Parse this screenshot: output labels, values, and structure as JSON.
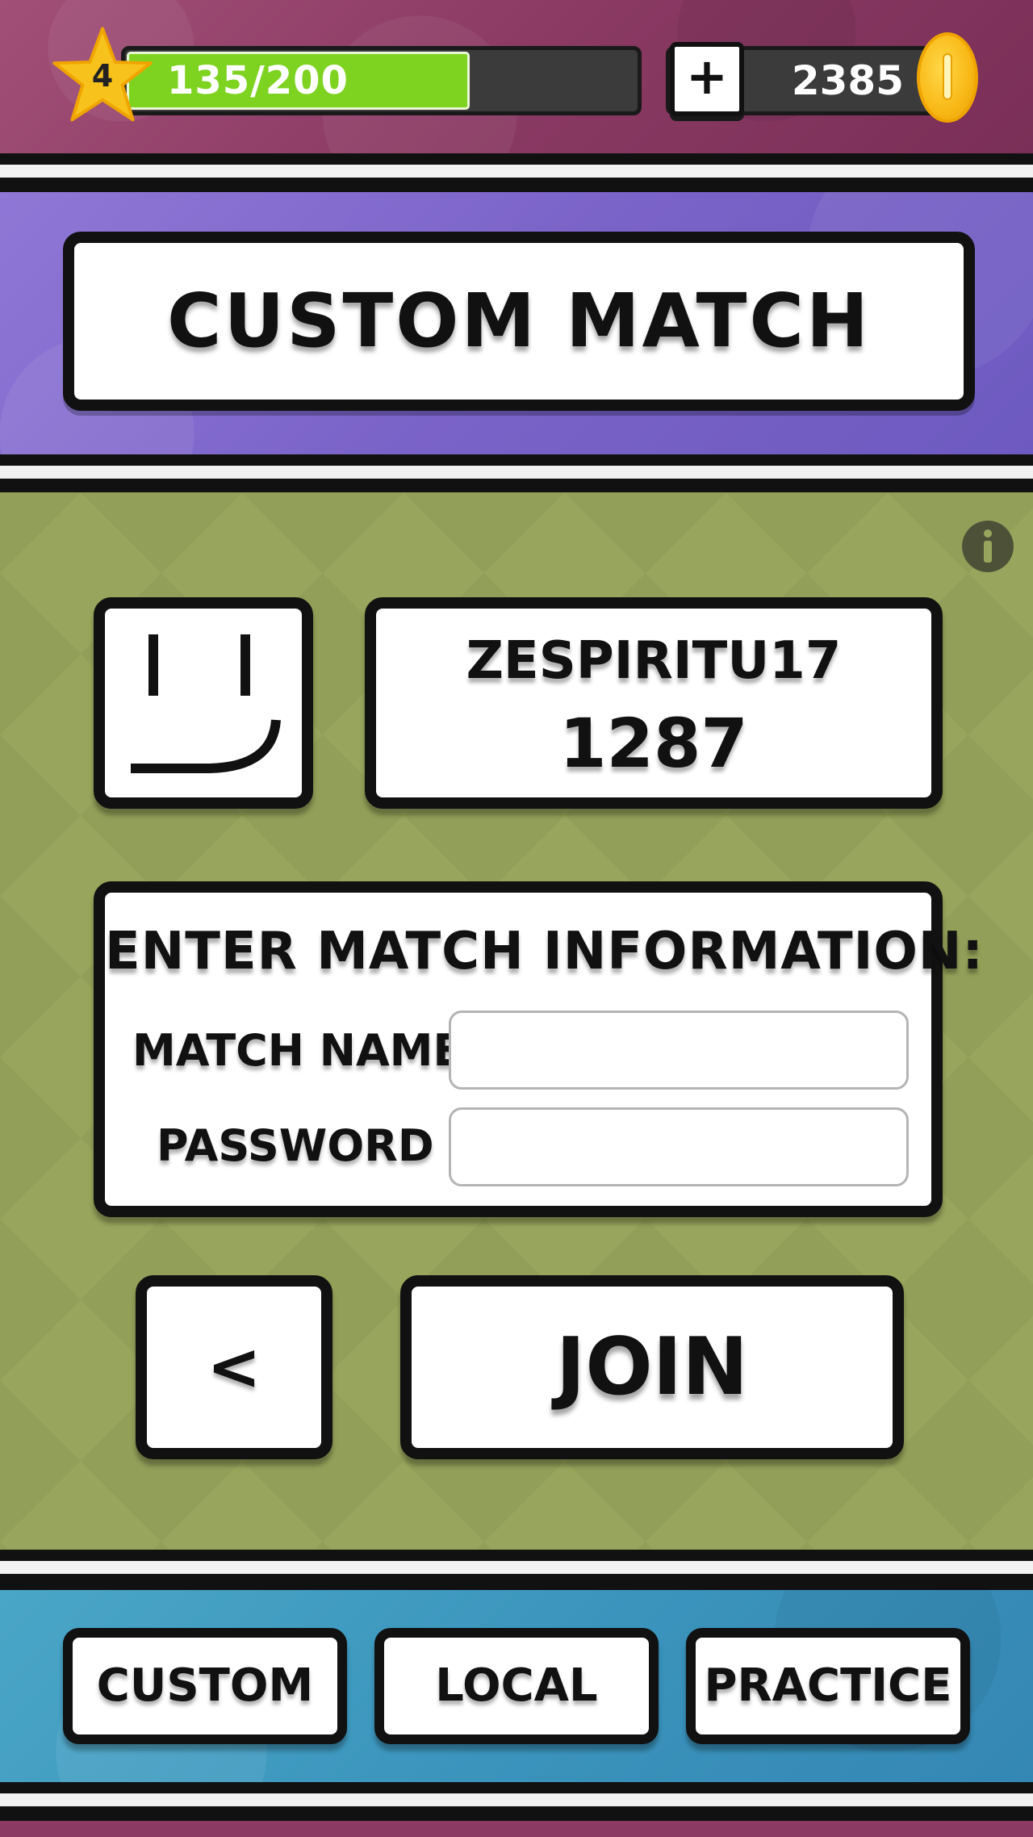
{
  "player": {
    "level": "4",
    "xp_text": "135/200",
    "xp_current": 135,
    "xp_max": 200
  },
  "currency": {
    "plus_label": "+",
    "coins": "2385"
  },
  "header": {
    "title": "CUSTOM MATCH"
  },
  "profile": {
    "username": "ZESPIRITU17",
    "rating": "1287"
  },
  "form": {
    "heading": "ENTER MATCH INFORMATION:",
    "match_name_label": "MATCH NAME",
    "match_name_value": "",
    "password_label": "PASSWORD",
    "password_value": ""
  },
  "actions": {
    "back_label": "<",
    "join_label": "JOIN"
  },
  "tabs": [
    {
      "label": "CUSTOM"
    },
    {
      "label": "LOCAL"
    },
    {
      "label": "PRACTICE"
    }
  ],
  "colors": {
    "top_bar": "#8a3a63",
    "title_band": "#7a63c8",
    "main_area": "#98a55c",
    "bottom_band": "#3b95bd",
    "xp_fill": "#7ed321",
    "coin": "#f8b815",
    "card": "#ffffff",
    "border": "#111111"
  }
}
